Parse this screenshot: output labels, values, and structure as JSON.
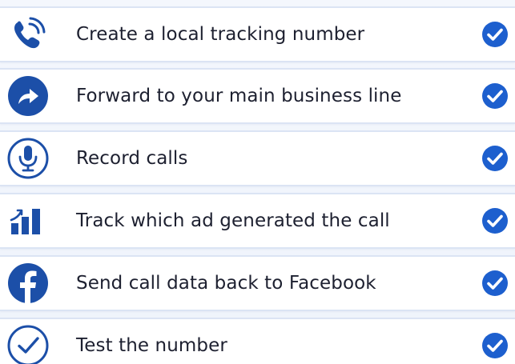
{
  "checklist": {
    "accent_color": "#1c4fa8",
    "check_color": "#1d5fce",
    "items": [
      {
        "icon": "phone-call-icon",
        "label": "Create a local tracking number",
        "done": true
      },
      {
        "icon": "forward-arrow-icon",
        "label": "Forward to your main business line",
        "done": true
      },
      {
        "icon": "microphone-icon",
        "label": "Record calls",
        "done": true
      },
      {
        "icon": "bar-chart-icon",
        "label": "Track which ad generated the call",
        "done": true
      },
      {
        "icon": "facebook-icon",
        "label": "Send call data back to Facebook",
        "done": true
      },
      {
        "icon": "check-circle-icon",
        "label": "Test the number",
        "done": true
      }
    ]
  }
}
